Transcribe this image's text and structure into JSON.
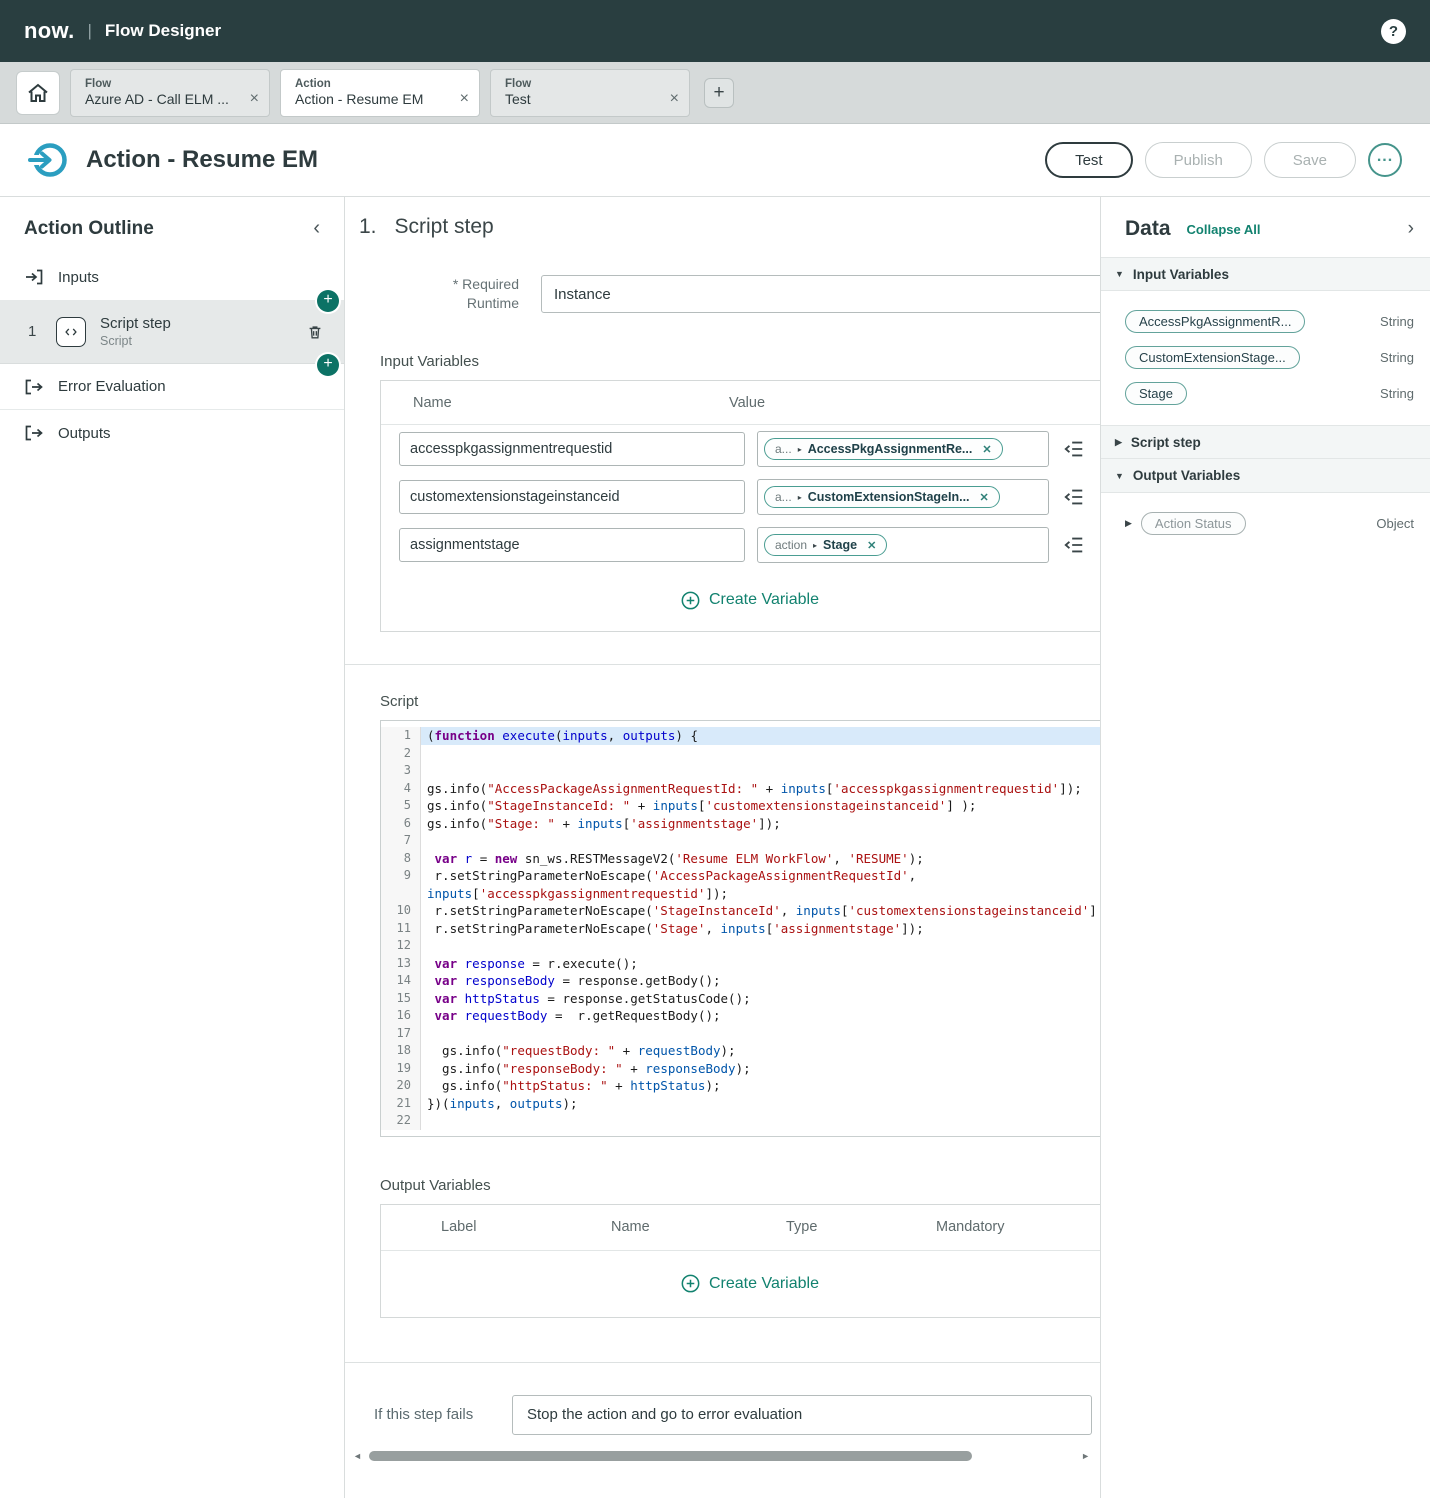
{
  "topbar": {
    "logo": "now.",
    "divider": "|",
    "app_title": "Flow Designer",
    "help_glyph": "?"
  },
  "glyphs": {
    "close": "×",
    "add": "+",
    "chevron_left": "‹",
    "chevron_right": "›",
    "caret_down": "▼",
    "caret_right": "▶",
    "pill_caret": "▸",
    "ellipsis": "...",
    "remove": "✕",
    "scroll_left": "◄",
    "scroll_right": "►"
  },
  "tabs": [
    {
      "type": "Flow",
      "title": "Azure AD - Call ELM ...",
      "active": false
    },
    {
      "type": "Action",
      "title": "Action - Resume EM",
      "active": true
    },
    {
      "type": "Flow",
      "title": "Test",
      "active": false
    }
  ],
  "page_header": {
    "title": "Action - Resume EM",
    "test_label": "Test",
    "publish_label": "Publish",
    "save_label": "Save"
  },
  "outline": {
    "title": "Action Outline",
    "inputs_label": "Inputs",
    "step": {
      "number": "1",
      "label": "Script step",
      "sublabel": "Script"
    },
    "error_label": "Error Evaluation",
    "outputs_label": "Outputs"
  },
  "main": {
    "step_number": "1.",
    "step_title": "Script step",
    "runtime": {
      "required_mark": "*",
      "label_line1": "Required",
      "label_line2": "Runtime",
      "value": "Instance"
    },
    "input_variables": {
      "title": "Input Variables",
      "name_col": "Name",
      "value_col": "Value",
      "rows": [
        {
          "name": "accesspkgassignmentrequestid",
          "pill_prefix": "a...",
          "pill_label": "AccessPkgAssignmentRe..."
        },
        {
          "name": "customextensionstageinstanceid",
          "pill_prefix": "a...",
          "pill_label": "CustomExtensionStageIn..."
        },
        {
          "name": "assignmentstage",
          "pill_prefix": "action",
          "pill_label": "Stage"
        }
      ],
      "create_label": "Create Variable"
    },
    "script": {
      "title": "Script",
      "lines": [
        {
          "n": "1",
          "hl": true,
          "parts": [
            [
              "t",
              "("
            ],
            [
              "k",
              "function"
            ],
            [
              "t",
              " "
            ],
            [
              "d",
              "execute"
            ],
            [
              "t",
              "("
            ],
            [
              "d",
              "inputs"
            ],
            [
              "t",
              ", "
            ],
            [
              "d",
              "outputs"
            ],
            [
              "t",
              ") {"
            ]
          ]
        },
        {
          "n": "2",
          "parts": []
        },
        {
          "n": "3",
          "parts": []
        },
        {
          "n": "4",
          "parts": [
            [
              "t",
              "gs.info("
            ],
            [
              "s",
              "\"AccessPackageAssignmentRequestId: \""
            ],
            [
              "t",
              " + "
            ],
            [
              "v",
              "inputs"
            ],
            [
              "t",
              "["
            ],
            [
              "s",
              "'accesspkgassignmentrequestid'"
            ],
            [
              "t",
              "]);"
            ]
          ]
        },
        {
          "n": "5",
          "parts": [
            [
              "t",
              "gs.info("
            ],
            [
              "s",
              "\"StageInstanceId: \""
            ],
            [
              "t",
              " + "
            ],
            [
              "v",
              "inputs"
            ],
            [
              "t",
              "["
            ],
            [
              "s",
              "'customextensionstageinstanceid'"
            ],
            [
              "t",
              "] );"
            ]
          ]
        },
        {
          "n": "6",
          "parts": [
            [
              "t",
              "gs.info("
            ],
            [
              "s",
              "\"Stage: \""
            ],
            [
              "t",
              " + "
            ],
            [
              "v",
              "inputs"
            ],
            [
              "t",
              "["
            ],
            [
              "s",
              "'assignmentstage'"
            ],
            [
              "t",
              "]);"
            ]
          ]
        },
        {
          "n": "7",
          "parts": []
        },
        {
          "n": "8",
          "parts": [
            [
              "t",
              " "
            ],
            [
              "k",
              "var"
            ],
            [
              "t",
              " "
            ],
            [
              "d",
              "r"
            ],
            [
              "t",
              " = "
            ],
            [
              "k",
              "new"
            ],
            [
              "t",
              " sn_ws.RESTMessageV2("
            ],
            [
              "s",
              "'Resume ELM WorkFlow'"
            ],
            [
              "t",
              ", "
            ],
            [
              "s",
              "'RESUME'"
            ],
            [
              "t",
              ");"
            ]
          ]
        },
        {
          "n": "9",
          "parts": [
            [
              "t",
              " r.setStringParameterNoEscape("
            ],
            [
              "s",
              "'AccessPackageAssignmentRequestId'"
            ],
            [
              "t",
              ","
            ]
          ]
        },
        {
          "n": "",
          "parts": [
            [
              "v",
              "inputs"
            ],
            [
              "t",
              "["
            ],
            [
              "s",
              "'accesspkgassignmentrequestid'"
            ],
            [
              "t",
              "]);"
            ]
          ]
        },
        {
          "n": "10",
          "parts": [
            [
              "t",
              " r.setStringParameterNoEscape("
            ],
            [
              "s",
              "'StageInstanceId'"
            ],
            [
              "t",
              ", "
            ],
            [
              "v",
              "inputs"
            ],
            [
              "t",
              "["
            ],
            [
              "s",
              "'customextensionstageinstanceid'"
            ],
            [
              "t",
              "] );"
            ]
          ]
        },
        {
          "n": "11",
          "parts": [
            [
              "t",
              " r.setStringParameterNoEscape("
            ],
            [
              "s",
              "'Stage'"
            ],
            [
              "t",
              ", "
            ],
            [
              "v",
              "inputs"
            ],
            [
              "t",
              "["
            ],
            [
              "s",
              "'assignmentstage'"
            ],
            [
              "t",
              "]);"
            ]
          ]
        },
        {
          "n": "12",
          "parts": []
        },
        {
          "n": "13",
          "parts": [
            [
              "t",
              " "
            ],
            [
              "k",
              "var"
            ],
            [
              "t",
              " "
            ],
            [
              "d",
              "response"
            ],
            [
              "t",
              " = r.execute();"
            ]
          ]
        },
        {
          "n": "14",
          "parts": [
            [
              "t",
              " "
            ],
            [
              "k",
              "var"
            ],
            [
              "t",
              " "
            ],
            [
              "d",
              "responseBody"
            ],
            [
              "t",
              " = response.getBody();"
            ]
          ]
        },
        {
          "n": "15",
          "parts": [
            [
              "t",
              " "
            ],
            [
              "k",
              "var"
            ],
            [
              "t",
              " "
            ],
            [
              "d",
              "httpStatus"
            ],
            [
              "t",
              " = response.getStatusCode();"
            ]
          ]
        },
        {
          "n": "16",
          "parts": [
            [
              "t",
              " "
            ],
            [
              "k",
              "var"
            ],
            [
              "t",
              " "
            ],
            [
              "d",
              "requestBody"
            ],
            [
              "t",
              " =  r.getRequestBody();"
            ]
          ]
        },
        {
          "n": "17",
          "parts": []
        },
        {
          "n": "18",
          "parts": [
            [
              "t",
              "  gs.info("
            ],
            [
              "s",
              "\"requestBody: \""
            ],
            [
              "t",
              " + "
            ],
            [
              "v",
              "requestBody"
            ],
            [
              "t",
              ");"
            ]
          ]
        },
        {
          "n": "19",
          "parts": [
            [
              "t",
              "  gs.info("
            ],
            [
              "s",
              "\"responseBody: \""
            ],
            [
              "t",
              " + "
            ],
            [
              "v",
              "responseBody"
            ],
            [
              "t",
              ");"
            ]
          ]
        },
        {
          "n": "20",
          "parts": [
            [
              "t",
              "  gs.info("
            ],
            [
              "s",
              "\"httpStatus: \""
            ],
            [
              "t",
              " + "
            ],
            [
              "v",
              "httpStatus"
            ],
            [
              "t",
              ");"
            ]
          ]
        },
        {
          "n": "21",
          "parts": [
            [
              "t",
              "})("
            ],
            [
              "v",
              "inputs"
            ],
            [
              "t",
              ", "
            ],
            [
              "v",
              "outputs"
            ],
            [
              "t",
              ");"
            ]
          ]
        },
        {
          "n": "22",
          "parts": []
        }
      ]
    },
    "output_variables": {
      "title": "Output Variables",
      "columns": [
        "Label",
        "Name",
        "Type",
        "Mandatory"
      ],
      "create_label": "Create Variable"
    },
    "failure": {
      "label": "If this step fails",
      "value": "Stop the action and go to error evaluation"
    }
  },
  "data_panel": {
    "title": "Data",
    "collapse_all_label": "Collapse All",
    "input_section_label": "Input Variables",
    "input_pills": [
      {
        "label": "AccessPkgAssignmentR...",
        "type": "String"
      },
      {
        "label": "CustomExtensionStage...",
        "type": "String"
      },
      {
        "label": "Stage",
        "type": "String"
      }
    ],
    "script_section_label": "Script step",
    "output_section_label": "Output Variables",
    "output_pills": [
      {
        "label": "Action Status",
        "type": "Object"
      }
    ]
  }
}
